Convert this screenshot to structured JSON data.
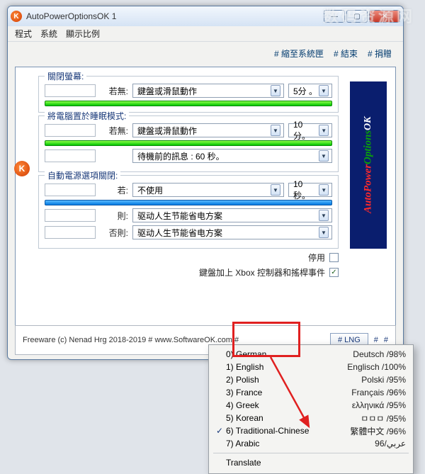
{
  "watermark": "数码资源网",
  "window": {
    "title": "AutoPowerOptionsOK 1",
    "controls": {
      "min": "—",
      "max": "▢",
      "close": "✕"
    }
  },
  "menu": {
    "program": "程式",
    "system": "系統",
    "display_ratio": "顯示比例"
  },
  "topbar": {
    "tray": "# 縮至系統匣",
    "end": "# 結束",
    "donate": "# 捐贈"
  },
  "group1": {
    "title": "關閉螢幕:",
    "if_none": "若無:",
    "condition": "鍵盤或滑鼠動作",
    "time": "5分 。"
  },
  "group2": {
    "title": "將電腦置於睡眠模式:",
    "if_none": "若無:",
    "condition": "鍵盤或滑鼠動作",
    "time": "10分。",
    "standby_msg": "待機前的訊息 : 60 秒。"
  },
  "group3": {
    "title": "自動電源選項關閉:",
    "if": "若:",
    "if_val": "不使用",
    "time": "10秒。",
    "then": "則:",
    "then_val": "驱动人生节能省电方案",
    "else": "否則:",
    "else_val": "驱动人生节能省电方案"
  },
  "bottom": {
    "disable": "停用",
    "xbox": "鍵盤加上 Xbox 控制器和搖桿事件"
  },
  "footer": {
    "credit": "Freeware (c) Nenad Hrg 2018-2019 # www.SoftwareOK.com #",
    "lng": "# LNG",
    "hash1": "#",
    "hash2": "#"
  },
  "art": {
    "w1": "AutoPower",
    "w2": "Options",
    "w3": "OK"
  },
  "lang": {
    "items": [
      {
        "idx": "0) German",
        "native": "Deutsch /98%",
        "checked": false
      },
      {
        "idx": "1) English",
        "native": "Englisch /100%",
        "checked": false
      },
      {
        "idx": "2) Polish",
        "native": "Polski /95%",
        "checked": false
      },
      {
        "idx": "3) France",
        "native": "Français /96%",
        "checked": false
      },
      {
        "idx": "4) Greek",
        "native": "ελληνικά /95%",
        "checked": false
      },
      {
        "idx": "5) Korean",
        "native": "ㅁㅁㅁ /95%",
        "checked": false
      },
      {
        "idx": "6) Traditional-Chinese",
        "native": "繁體中文 /96%",
        "checked": true
      },
      {
        "idx": "7) Arabic",
        "native": "عربي/96",
        "checked": false
      }
    ],
    "translate": "Translate"
  }
}
